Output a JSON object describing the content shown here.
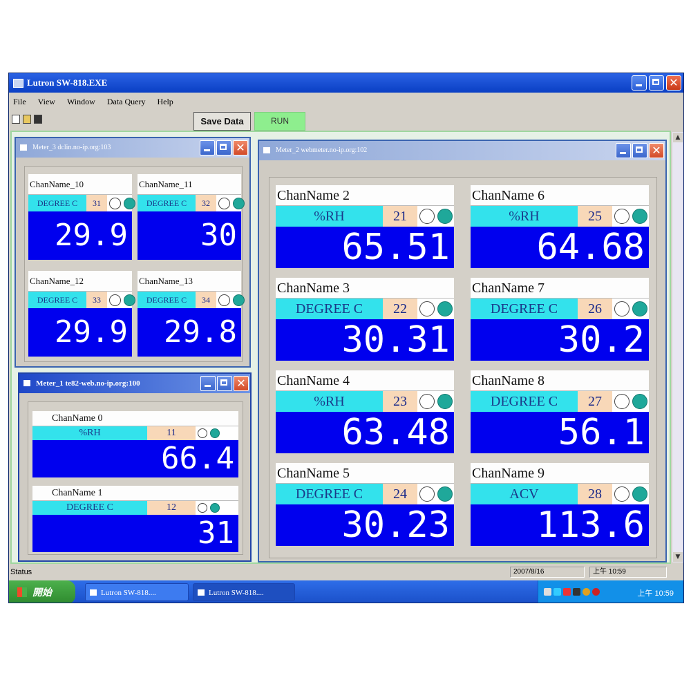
{
  "app": {
    "title": "Lutron SW-818.EXE",
    "menu": [
      "File",
      "View",
      "Window",
      "Data Query",
      "Help"
    ],
    "toolbar_icons": [
      "new-icon",
      "open-icon",
      "save-icon"
    ],
    "save_data_label": "Save Data",
    "run_label": "RUN"
  },
  "windows": {
    "meter3": {
      "title": "Meter_3  dclin.no-ip.org:103",
      "meters": [
        {
          "name": "ChanName_10",
          "unit": "DEGREE C",
          "chan": "31",
          "value": "29.9"
        },
        {
          "name": "ChanName_11",
          "unit": "DEGREE C",
          "chan": "32",
          "value": "30"
        },
        {
          "name": "ChanName_12",
          "unit": "DEGREE C",
          "chan": "33",
          "value": "29.9"
        },
        {
          "name": "ChanName_13",
          "unit": "DEGREE C",
          "chan": "34",
          "value": "29.8"
        }
      ]
    },
    "meter1": {
      "title": "Meter_1  te82-web.no-ip.org:100",
      "meters": [
        {
          "name": "ChanName  0",
          "unit": "%RH",
          "chan": "11",
          "value": "66.4"
        },
        {
          "name": "ChanName  1",
          "unit": "DEGREE C",
          "chan": "12",
          "value": "31"
        }
      ]
    },
    "meter2": {
      "title": "Meter_2  webmeter.no-ip.org:102",
      "meters": [
        {
          "name": "ChanName  2",
          "unit": "%RH",
          "chan": "21",
          "value": "65.51"
        },
        {
          "name": "ChanName  6",
          "unit": "%RH",
          "chan": "25",
          "value": "64.68"
        },
        {
          "name": "ChanName  3",
          "unit": "DEGREE C",
          "chan": "22",
          "value": "30.31"
        },
        {
          "name": "ChanName  7",
          "unit": "DEGREE C",
          "chan": "26",
          "value": "30.2"
        },
        {
          "name": "ChanName  4",
          "unit": "%RH",
          "chan": "23",
          "value": "63.48"
        },
        {
          "name": "ChanName  8",
          "unit": "DEGREE C",
          "chan": "27",
          "value": "56.1"
        },
        {
          "name": "ChanName  5",
          "unit": "DEGREE C",
          "chan": "24",
          "value": "30.23"
        },
        {
          "name": "ChanName  9",
          "unit": "ACV",
          "chan": "28",
          "value": "113.6"
        }
      ]
    }
  },
  "status": {
    "label": "Status",
    "date": "2007/8/16",
    "time": "上午 10:59"
  },
  "taskbar": {
    "start_label": "開始",
    "tasks": [
      "Lutron SW-818....",
      "Lutron SW-818...."
    ],
    "clock": "上午 10:59"
  }
}
